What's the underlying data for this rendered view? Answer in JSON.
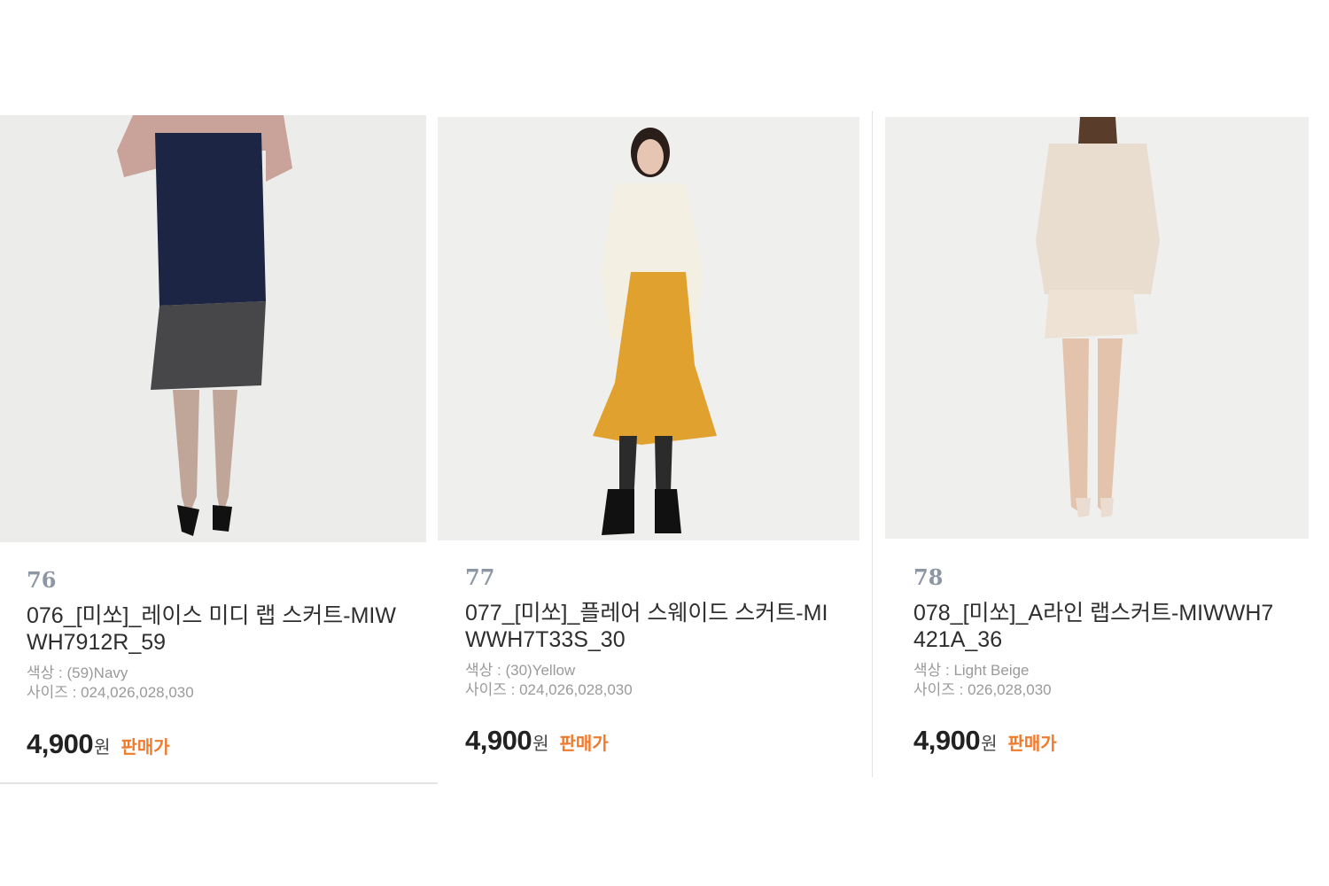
{
  "products": [
    {
      "number": "76",
      "title": "076_[미쏘]_레이스 미디 랩 스커트-MIWWH7912R_59",
      "color_text": "색상 : (59)Navy",
      "size_text": "사이즈 : 024,026,028,030",
      "price": "4,900",
      "currency": "원",
      "price_label": "판매가"
    },
    {
      "number": "77",
      "title": "077_[미쏘]_플레어 스웨이드 스커트-MIWWH7T33S_30",
      "color_text": "색상 : (30)Yellow",
      "size_text": "사이즈 : 024,026,028,030",
      "price": "4,900",
      "currency": "원",
      "price_label": "판매가"
    },
    {
      "number": "78",
      "title": "078_[미쏘]_A라인 랩스커트-MIWWH7421A_36",
      "color_text": "색상 : Light Beige",
      "size_text": "사이즈 : 026,028,030",
      "price": "4,900",
      "currency": "원",
      "price_label": "판매가"
    }
  ],
  "colors": {
    "price_label": "#f07a2c",
    "number": "#8d96a5",
    "photo_bg": "#efefee"
  }
}
